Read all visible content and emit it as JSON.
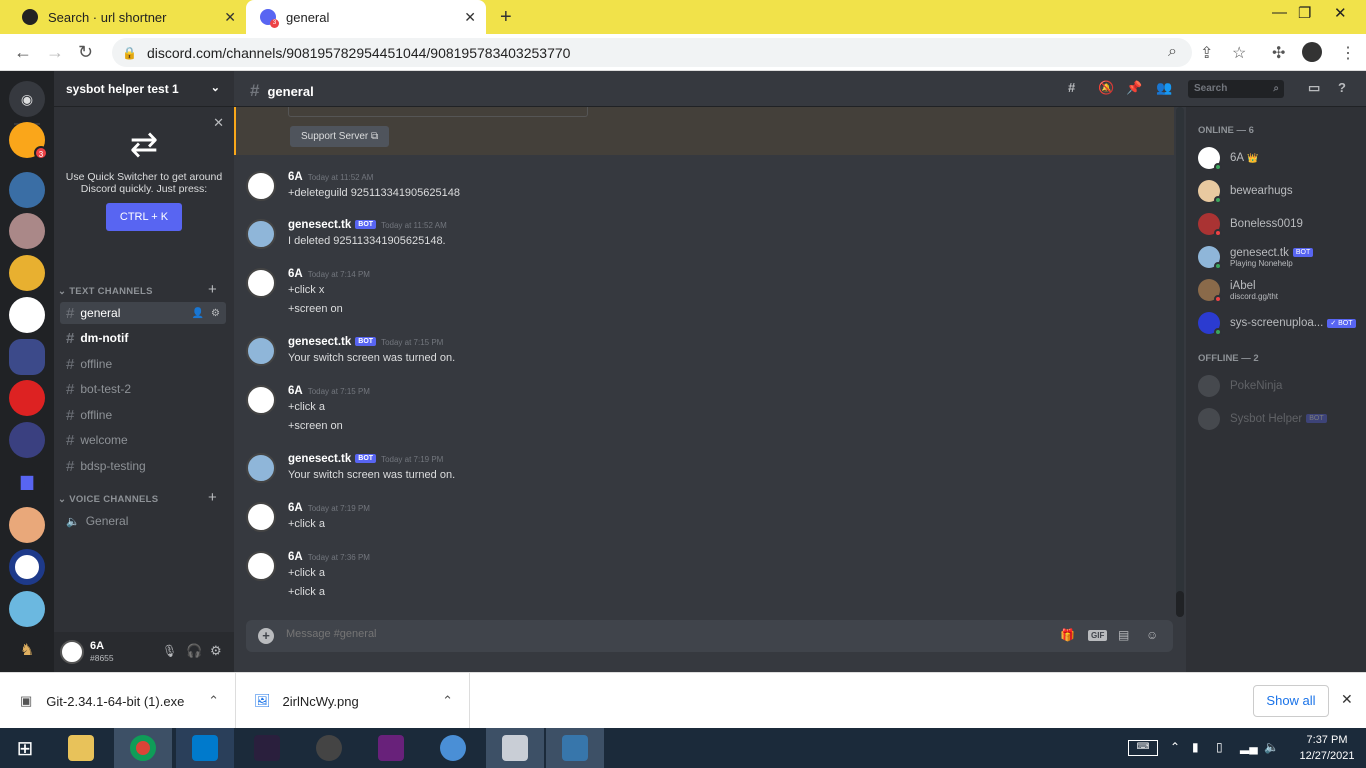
{
  "browser": {
    "tabs": [
      {
        "title": "Search · url shortner",
        "icon": "github-icon"
      },
      {
        "title": "general",
        "icon": "discord-icon",
        "badge": "3"
      }
    ],
    "url": "discord.com/channels/908195782954451044/908195783403253770"
  },
  "discord": {
    "server_name": "sysbot helper test 1",
    "guild_badge": "3",
    "quick_switcher": {
      "text": "Use Quick Switcher to get around Discord quickly. Just press:",
      "shortcut": "CTRL + K"
    },
    "text_category": "TEXT CHANNELS",
    "voice_category": "VOICE CHANNELS",
    "text_channels": [
      "general",
      "dm-notif",
      "offline",
      "bot-test-2",
      "offline",
      "welcome",
      "bdsp-testing"
    ],
    "voice_channels": [
      "General"
    ],
    "user": {
      "name": "6A",
      "tag": "#8655"
    },
    "channel_title": "general",
    "search_placeholder": "Search",
    "support_button": "Support Server",
    "messages": [
      {
        "author": "6A",
        "time": "Today at 11:52 AM",
        "bot": false,
        "lines": [
          "+deleteguild 925113341905625148"
        ]
      },
      {
        "author": "genesect.tk",
        "time": "Today at 11:52 AM",
        "bot": true,
        "lines": [
          "I deleted 925113341905625148."
        ]
      },
      {
        "author": "6A",
        "time": "Today at 7:14 PM",
        "bot": false,
        "lines": [
          "+click x",
          "+screen on"
        ]
      },
      {
        "author": "genesect.tk",
        "time": "Today at 7:15 PM",
        "bot": true,
        "lines": [
          "Your switch screen was turned on."
        ]
      },
      {
        "author": "6A",
        "time": "Today at 7:15 PM",
        "bot": false,
        "lines": [
          "+click a",
          "+screen on"
        ]
      },
      {
        "author": "genesect.tk",
        "time": "Today at 7:19 PM",
        "bot": true,
        "lines": [
          "Your switch screen was turned on."
        ]
      },
      {
        "author": "6A",
        "time": "Today at 7:19 PM",
        "bot": false,
        "lines": [
          "+click a"
        ]
      },
      {
        "author": "6A",
        "time": "Today at 7:36 PM",
        "bot": false,
        "lines": [
          "+click a",
          "+click a"
        ]
      }
    ],
    "bot_tag": "BOT",
    "verified_bot_tag": "✓ BOT",
    "composer_placeholder": "Message #general",
    "gif_label": "GIF",
    "members": {
      "online_label": "ONLINE — 6",
      "offline_label": "OFFLINE — 2",
      "online": [
        {
          "name": "6A",
          "crown": "👑",
          "status": "online",
          "sub": ""
        },
        {
          "name": "bewearhugs",
          "status": "online",
          "sub": ""
        },
        {
          "name": "Boneless0019",
          "status": "dnd",
          "sub": ""
        },
        {
          "name": "genesect.tk",
          "status": "online",
          "bot": true,
          "sub": "Playing Nonehelp"
        },
        {
          "name": "iAbel",
          "status": "dnd",
          "sub": "discord.gg/tht"
        },
        {
          "name": "sys-screenuploa...",
          "status": "online",
          "bot": true,
          "verified": true,
          "sub": ""
        }
      ],
      "offline": [
        {
          "name": "PokeNinja",
          "sub": ""
        },
        {
          "name": "Sysbot Helper",
          "bot": true,
          "sub": ""
        }
      ]
    }
  },
  "downloads": {
    "items": [
      "Git-2.34.1-64-bit (1).exe",
      "2irlNcWy.png"
    ],
    "show_all": "Show all"
  },
  "taskbar": {
    "time": "7:37 PM",
    "date": "12/27/2021"
  },
  "colors": {
    "tab_strip": "#f1e24a",
    "discord_blurple": "#5865f2",
    "online": "#3ba55c",
    "dnd": "#ed4245"
  }
}
